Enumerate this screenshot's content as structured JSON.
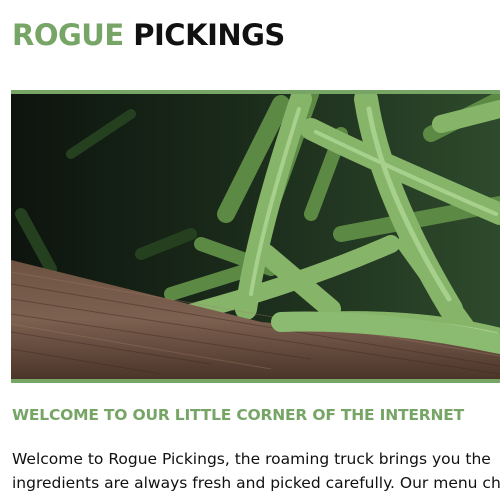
{
  "brand": {
    "part1": "ROGUE",
    "part2": "PICKINGS"
  },
  "hero": {
    "image": "green-beans-photo"
  },
  "welcome": {
    "title": "WELCOME TO OUR LITTLE CORNER OF THE INTERNET",
    "line1": "Welcome to Rogue Pickings, the roaming truck brings you the",
    "line2": "ingredients are always fresh and picked carefully. Our menu ch"
  },
  "colors": {
    "accent": "#76a566",
    "text": "#111111"
  }
}
